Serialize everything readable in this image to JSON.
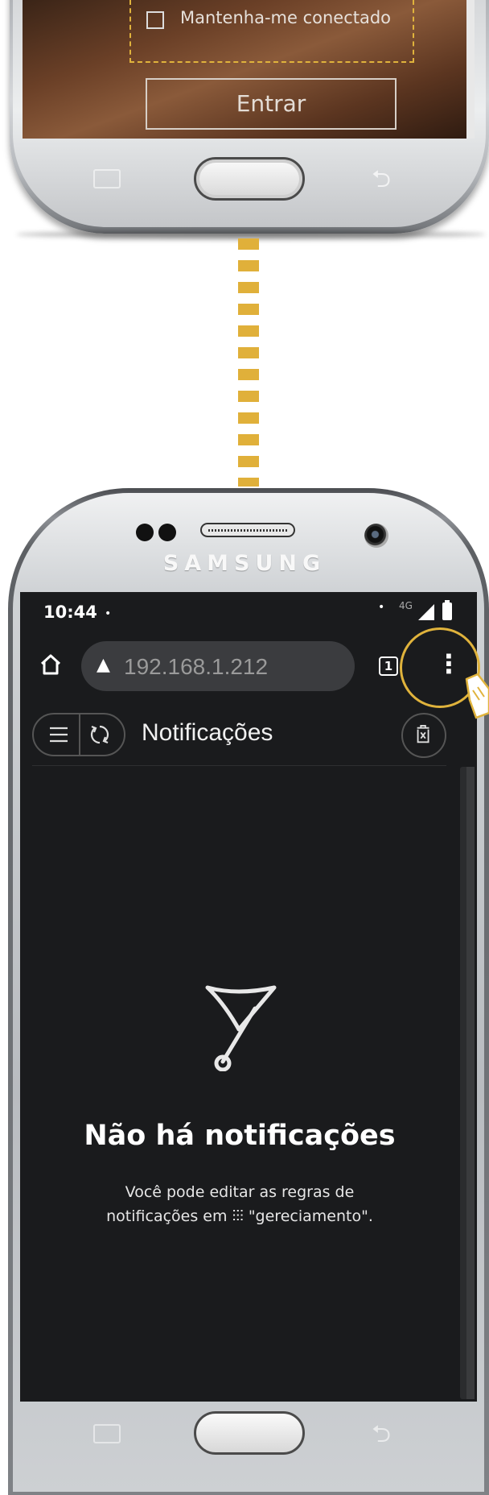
{
  "login": {
    "remember_label": "Mantenha-me conectado",
    "submit_label": "Entrar"
  },
  "device": {
    "brand": "SAMSUNG"
  },
  "status_bar": {
    "time": "10:44",
    "dot": "•",
    "right_dot": "•",
    "network": "4G"
  },
  "browser": {
    "url": "192.168.1.212",
    "warning_icon": "warning-triangle-icon",
    "tab_count": "1",
    "menu_glyph": "⋮"
  },
  "page": {
    "title": "Notificações",
    "empty_title": "Não há notificações",
    "empty_desc_line1": "Você pode editar as regras de",
    "empty_desc_line2": "notificações em ⫶⫶⫶ \"gereciamento\"."
  },
  "colors": {
    "accent": "#e0b33c",
    "screen_bg": "#1a1b1d",
    "url_bar_bg": "#3b3c3f"
  }
}
